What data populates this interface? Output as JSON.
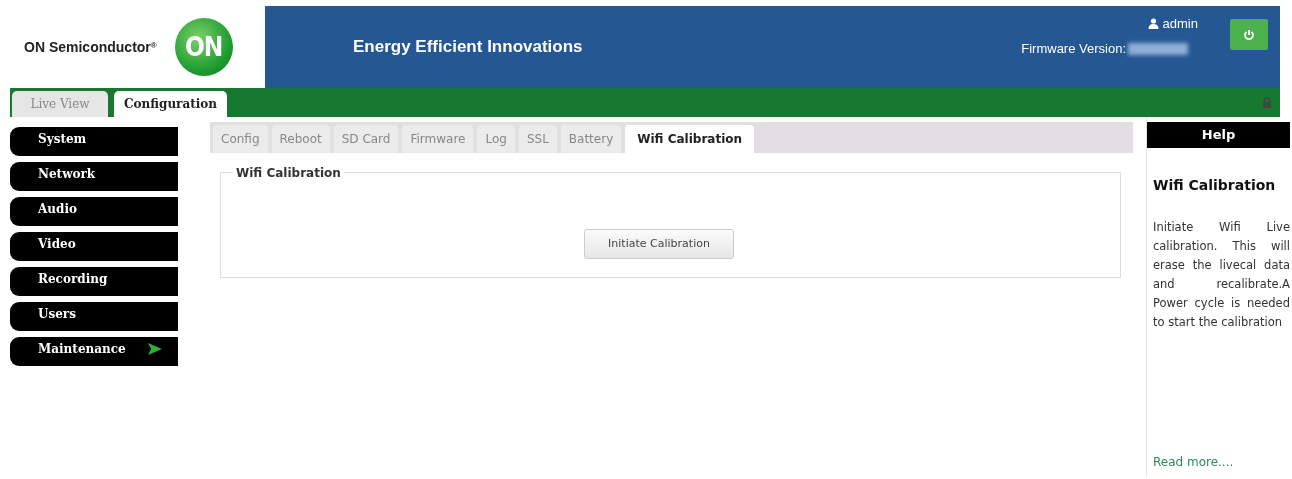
{
  "header": {
    "brand": "ON Semiconductor",
    "brand_mark": "®",
    "logo_text": "ON",
    "tagline": "Energy Efficient Innovations",
    "user": "admin",
    "firmware_label": "Firmware Version:"
  },
  "main_tabs": [
    {
      "label": "Live View",
      "selected": false
    },
    {
      "label": "Configuration",
      "selected": true
    }
  ],
  "sidebar": {
    "items": [
      {
        "label": "System",
        "selected": false
      },
      {
        "label": "Network",
        "selected": false
      },
      {
        "label": "Audio",
        "selected": false
      },
      {
        "label": "Video",
        "selected": false
      },
      {
        "label": "Recording",
        "selected": false
      },
      {
        "label": "Users",
        "selected": false
      },
      {
        "label": "Maintenance",
        "selected": true
      }
    ]
  },
  "sub_tabs": [
    {
      "label": "Config",
      "selected": false
    },
    {
      "label": "Reboot",
      "selected": false
    },
    {
      "label": "SD Card",
      "selected": false
    },
    {
      "label": "Firmware",
      "selected": false
    },
    {
      "label": "Log",
      "selected": false
    },
    {
      "label": "SSL",
      "selected": false
    },
    {
      "label": "Battery",
      "selected": false
    },
    {
      "label": "Wifi Calibration",
      "selected": true
    }
  ],
  "panel": {
    "legend": "Wifi Calibration",
    "button": "Initiate Calibration"
  },
  "help": {
    "header": "Help",
    "title": "Wifi Calibration",
    "text": "Initiate Wifi Live calibration. This will erase the livecal data and recalibrate.A Power cycle is needed to start the calibration",
    "link": "Read more...."
  }
}
